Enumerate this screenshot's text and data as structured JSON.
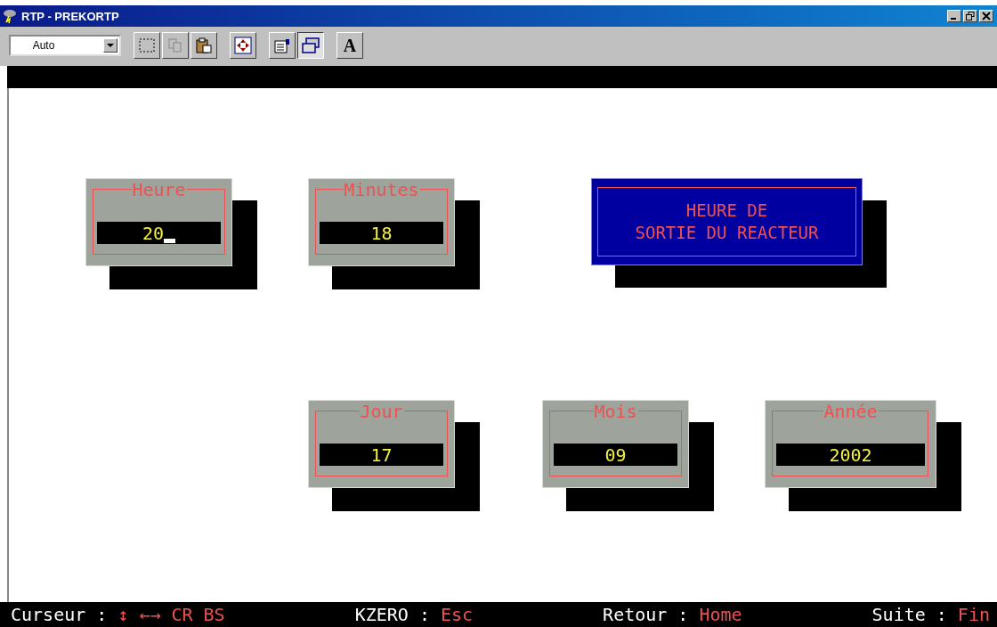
{
  "window": {
    "title": "RTP - PREKORTP"
  },
  "toolbar": {
    "zoom_select": {
      "value": "Auto"
    },
    "tools": [
      {
        "kind": "select",
        "selected": false
      },
      {
        "kind": "copy",
        "selected": false,
        "disabled": true
      },
      {
        "kind": "paste",
        "selected": false
      },
      {
        "kind": "fullscreen",
        "selected": false
      },
      {
        "kind": "properties",
        "selected": false
      },
      {
        "kind": "background",
        "selected": true
      },
      {
        "kind": "font",
        "selected": false,
        "text": "A"
      }
    ]
  },
  "rows": [
    {
      "kind": "time",
      "items": [
        {
          "kind": "field",
          "label": "Heure",
          "value": "20",
          "cursor": true
        },
        {
          "kind": "field",
          "label": "Minutes",
          "value": "18",
          "cursor": false
        },
        {
          "kind": "banner",
          "lines": [
            "HEURE DE",
            "SORTIE DU REACTEUR"
          ]
        }
      ]
    },
    {
      "kind": "date",
      "items": [
        {
          "kind": "field",
          "label": "Jour",
          "value": "17",
          "cursor": false
        },
        {
          "kind": "field",
          "label": "Mois",
          "value": "09",
          "cursor": false
        },
        {
          "kind": "field",
          "label": "Année",
          "value": "2002",
          "cursor": false
        }
      ]
    }
  ],
  "status_bar": [
    {
      "label": "Curseur",
      "separator": ":",
      "keys": [
        "↕",
        "←→",
        "CR",
        "BS"
      ]
    },
    {
      "label": "KZERO",
      "separator": ":",
      "keys": [
        "Esc"
      ]
    },
    {
      "label": "Retour",
      "separator": ":",
      "keys": [
        "Home"
      ]
    },
    {
      "label": "Suite",
      "separator": ":",
      "keys": [
        "Fin"
      ]
    }
  ]
}
